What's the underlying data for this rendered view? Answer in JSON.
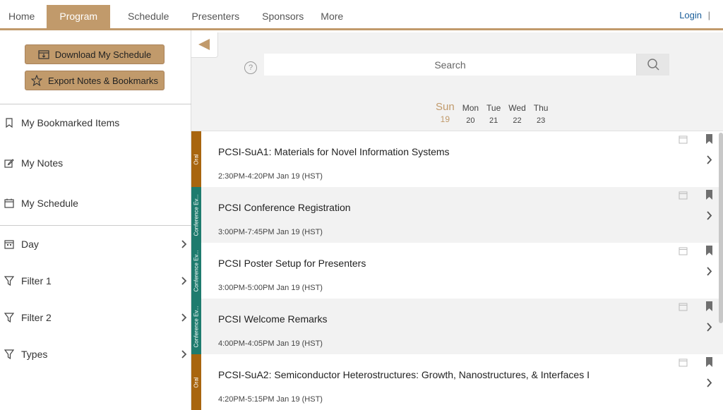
{
  "nav": {
    "tabs": [
      "Home",
      "Program",
      "Schedule",
      "Presenters",
      "Sponsors",
      "More"
    ],
    "active": "Program",
    "login": "Login",
    "separator": "|"
  },
  "sidebar": {
    "download_label": "Download My Schedule",
    "export_label": "Export Notes & Bookmarks",
    "items": [
      {
        "label": "My Bookmarked Items",
        "icon": "bookmark-icon"
      },
      {
        "label": "My Notes",
        "icon": "note-edit-icon"
      },
      {
        "label": "My Schedule",
        "icon": "calendar-icon"
      }
    ],
    "filters": [
      {
        "label": "Day",
        "icon": "calendar-day-icon"
      },
      {
        "label": "Filter 1",
        "icon": "filter-icon"
      },
      {
        "label": "Filter 2",
        "icon": "filter-icon"
      },
      {
        "label": "Types",
        "icon": "filter-icon"
      }
    ]
  },
  "search": {
    "placeholder": "Search",
    "help": "?"
  },
  "days": [
    {
      "name": "Sun",
      "date": "19",
      "active": true
    },
    {
      "name": "Mon",
      "date": "20"
    },
    {
      "name": "Tue",
      "date": "21"
    },
    {
      "name": "Wed",
      "date": "22"
    },
    {
      "name": "Thu",
      "date": "23"
    }
  ],
  "sessions": [
    {
      "type": "Oral",
      "color": "#a8650f",
      "title": "PCSI-SuA1: Materials for Novel Information Systems",
      "time": "2:30PM-4:20PM Jan 19 (HST)"
    },
    {
      "type": "Conference Ev...",
      "color": "#1e7b6e",
      "title": "PCSI Conference Registration",
      "time": "3:00PM-7:45PM Jan 19 (HST)"
    },
    {
      "type": "Conference Ev...",
      "color": "#1e7b6e",
      "title": "PCSI Poster Setup for Presenters",
      "time": "3:00PM-5:00PM Jan 19 (HST)"
    },
    {
      "type": "Conference Ev...",
      "color": "#1e7b6e",
      "title": "PCSI Welcome Remarks",
      "time": "4:00PM-4:05PM Jan 19 (HST)"
    },
    {
      "type": "Oral",
      "color": "#a8650f",
      "title": "PCSI-SuA2: Semiconductor Heterostructures: Growth, Nanostructures, & Interfaces I",
      "time": "4:20PM-5:15PM Jan 19 (HST)"
    }
  ],
  "colors": {
    "accent": "#c19a6b",
    "oral": "#a8650f",
    "event": "#1e7b6e"
  }
}
